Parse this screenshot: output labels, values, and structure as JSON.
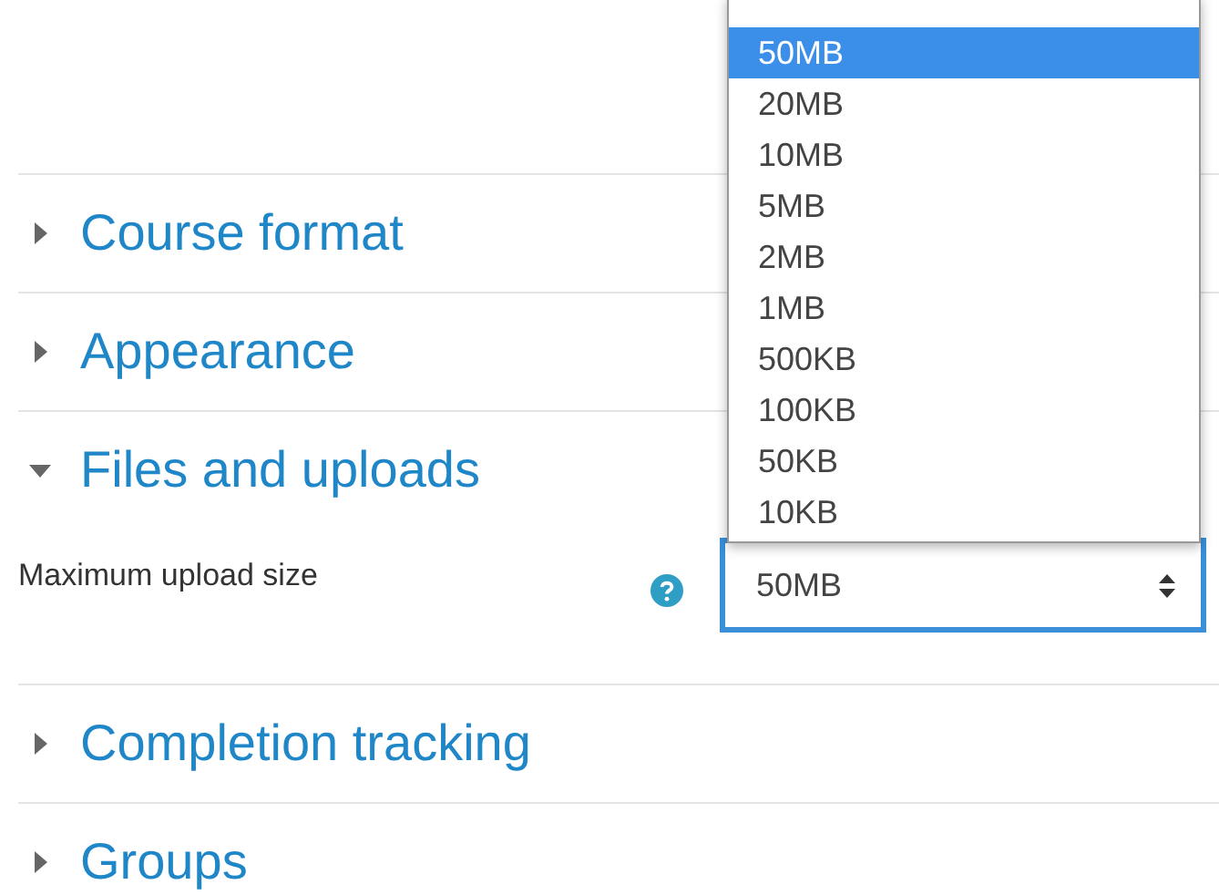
{
  "sections": [
    {
      "title": "Course format",
      "expanded": false
    },
    {
      "title": "Appearance",
      "expanded": false
    },
    {
      "title": "Files and uploads",
      "expanded": true,
      "fields": [
        {
          "label": "Maximum upload size",
          "select": {
            "value": "50MB",
            "open": true,
            "options": [
              {
                "label": "50MB",
                "selected": true
              },
              {
                "label": "20MB",
                "selected": false
              },
              {
                "label": "10MB",
                "selected": false
              },
              {
                "label": "5MB",
                "selected": false
              },
              {
                "label": "2MB",
                "selected": false
              },
              {
                "label": "1MB",
                "selected": false
              },
              {
                "label": "500KB",
                "selected": false
              },
              {
                "label": "100KB",
                "selected": false
              },
              {
                "label": "50KB",
                "selected": false
              },
              {
                "label": "10KB",
                "selected": false
              }
            ]
          }
        }
      ]
    },
    {
      "title": "Completion tracking",
      "expanded": false
    },
    {
      "title": "Groups",
      "expanded": false
    }
  ]
}
